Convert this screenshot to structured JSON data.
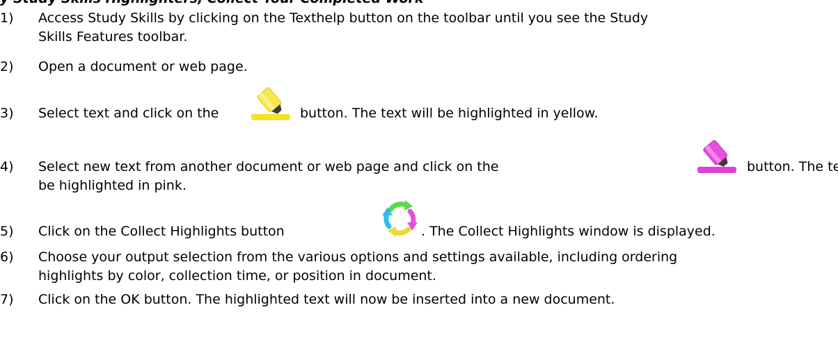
{
  "document": {
    "heading": "y Study Skills Highlighters, Collect Your Completed Work",
    "steps": [
      {
        "number": "1)",
        "line1": "Access Study Skills by clicking on the Texthelp button on the toolbar until you see the Study",
        "line2": "Skills Features toolbar."
      },
      {
        "number": "2)",
        "line1": "Open a document or web page."
      },
      {
        "number": "3)",
        "before": "Select text and click on the",
        "after": "button. The text will be highlighted in yellow.",
        "icon": "yellow-highlighter-icon"
      },
      {
        "number": "4)",
        "before": "Select new text from another document or web page and click on the",
        "after": "button. The text will",
        "line2": "be highlighted in pink.",
        "icon": "pink-highlighter-icon"
      },
      {
        "number": "5)",
        "before": "Click on the Collect Highlights button",
        "after": ". The Collect Highlights window is displayed.",
        "icon": "collect-highlights-icon"
      },
      {
        "number": "6)",
        "line1": "Choose your output selection from the various options and settings available, including ordering",
        "line2": "highlights by color, collection time, or position in document."
      },
      {
        "number": "7)",
        "line1": "Click on the OK button. The highlighted text will now be inserted into a new document."
      }
    ]
  },
  "colors": {
    "text": "#000000",
    "yellow_highlighter": "#f5e22b",
    "pink_highlighter": "#e03fd6",
    "cycle_green": "#5ad84a",
    "cycle_pink": "#e64fd8",
    "cycle_yellow": "#f2d82e",
    "cycle_cyan": "#2fc0e8"
  }
}
